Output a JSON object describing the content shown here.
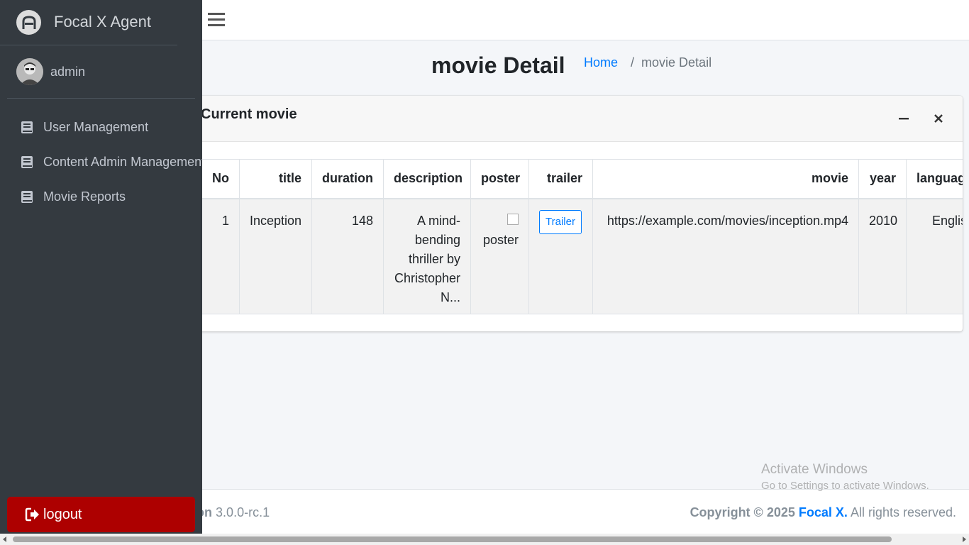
{
  "sidebar": {
    "brand": "Focal X Agent",
    "user": "admin",
    "items": [
      {
        "label": "User Management"
      },
      {
        "label": "Content Admin Management"
      },
      {
        "label": "Movie Reports"
      }
    ],
    "logout_label": "logout"
  },
  "header": {
    "title": "movie Detail",
    "breadcrumb": {
      "home": "Home",
      "current": "movie Detail"
    }
  },
  "card": {
    "title": "Current movie",
    "columns": [
      "No",
      "title",
      "duration",
      "description",
      "poster",
      "trailer",
      "movie",
      "year",
      "language"
    ],
    "rows": [
      {
        "no": "1",
        "title": "Inception",
        "duration": "148",
        "description": "A mind-bending thriller by Christopher N...",
        "poster_alt": "poster",
        "trailer_label": "Trailer",
        "movie": "https://example.com/movies/inception.mp4",
        "year": "2010",
        "language": "English"
      }
    ]
  },
  "footer": {
    "version_label": "ersion",
    "version": "3.0.0-rc.1",
    "copyright": "Copyright © 2025",
    "company": "Focal X.",
    "rights": "All rights reserved."
  },
  "watermark": {
    "title": "Activate Windows",
    "subtitle": "Go to Settings to activate Windows."
  }
}
